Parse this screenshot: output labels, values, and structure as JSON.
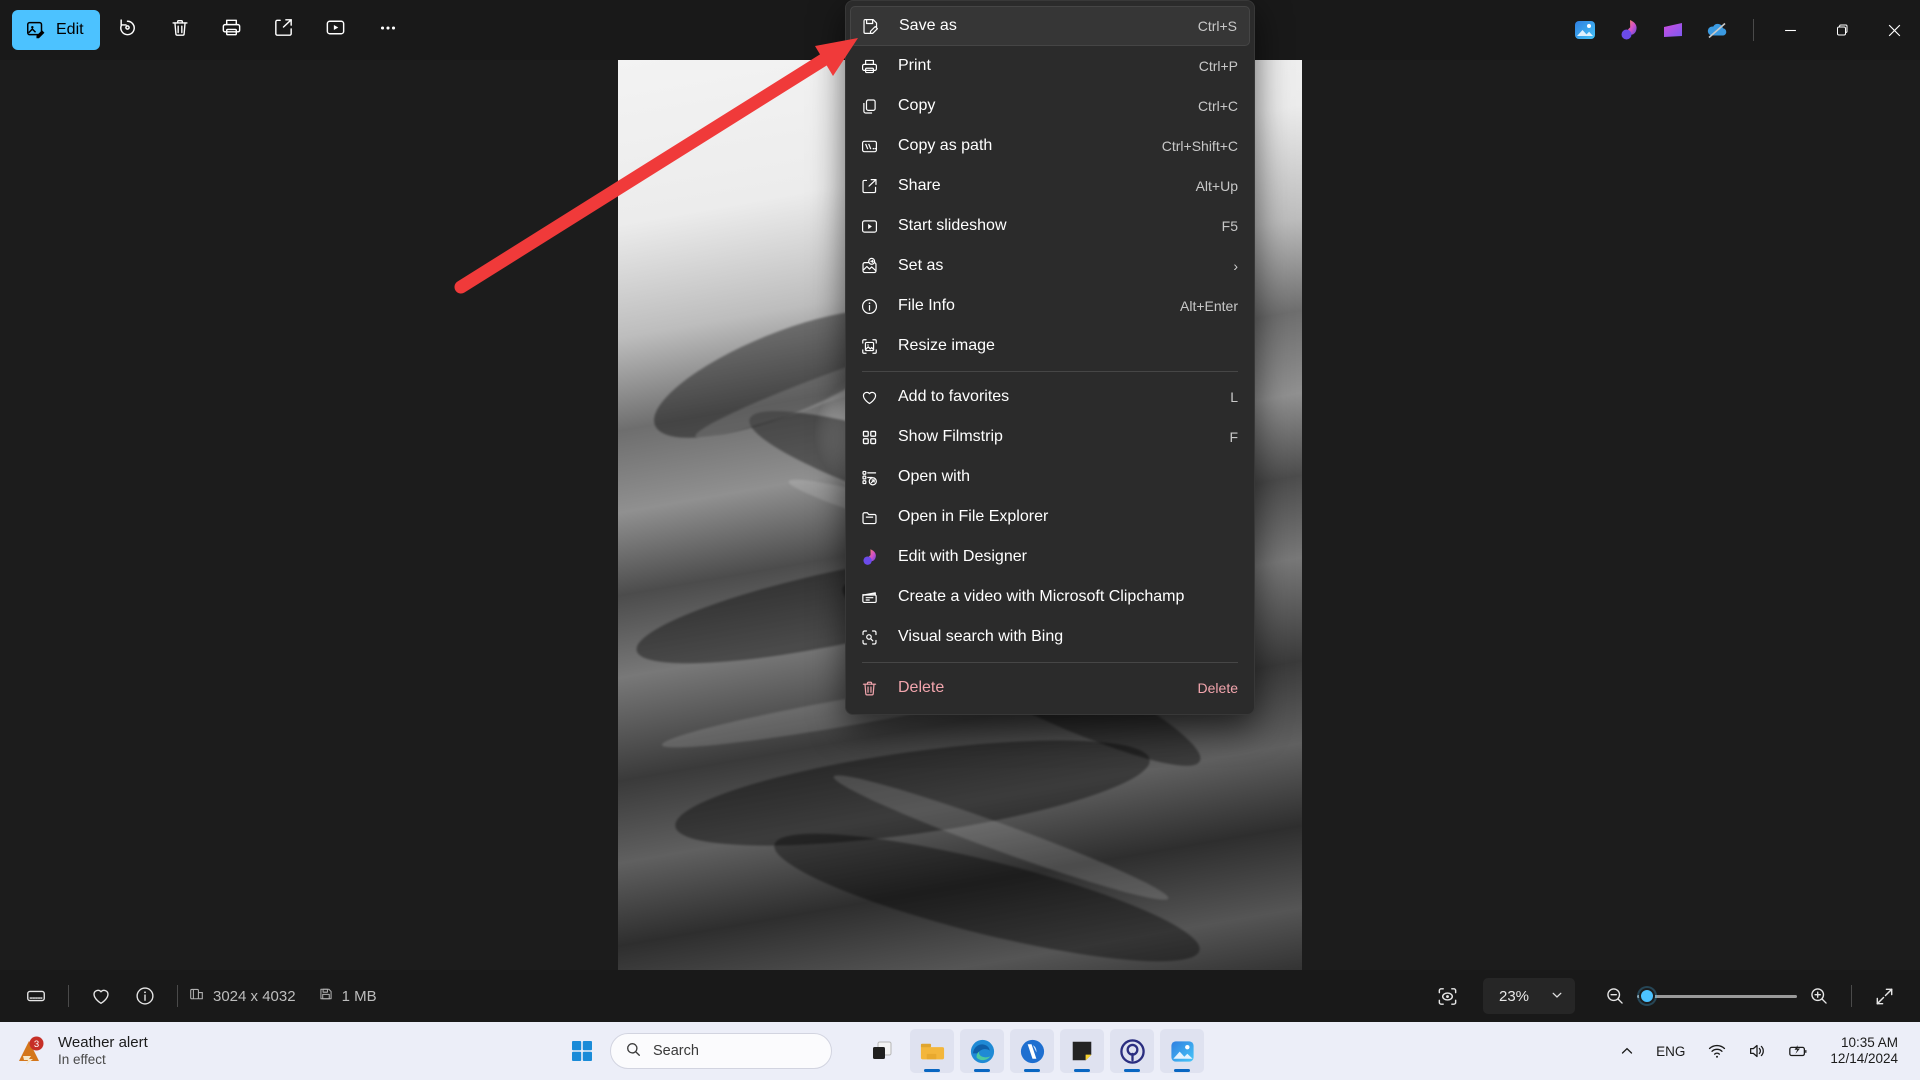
{
  "toolbar": {
    "edit_label": "Edit",
    "buttons": [
      {
        "name": "rotate-icon",
        "title": "Rotate"
      },
      {
        "name": "delete-icon",
        "title": "Delete"
      },
      {
        "name": "print-icon",
        "title": "Print"
      },
      {
        "name": "share-icon",
        "title": "Share"
      },
      {
        "name": "slideshow-icon",
        "title": "Start slideshow"
      },
      {
        "name": "more-icon",
        "title": "See more"
      }
    ],
    "app_icons": [
      "photos-icon",
      "designer-icon",
      "clipchamp-icon",
      "onedrive-paused-icon"
    ],
    "window_controls": {
      "minimize": "—",
      "maximize": "❐",
      "close": "✕"
    }
  },
  "context_menu": {
    "items": [
      {
        "label": "Save as",
        "accel": "Ctrl+S",
        "icon": "save-as-icon",
        "selected": true,
        "sep_after": false
      },
      {
        "label": "Print",
        "accel": "Ctrl+P",
        "icon": "print-icon",
        "selected": false,
        "sep_after": false
      },
      {
        "label": "Copy",
        "accel": "Ctrl+C",
        "icon": "copy-icon",
        "selected": false,
        "sep_after": false
      },
      {
        "label": "Copy as path",
        "accel": "Ctrl+Shift+C",
        "icon": "copy-path-icon",
        "selected": false,
        "sep_after": false
      },
      {
        "label": "Share",
        "accel": "Alt+Up",
        "icon": "share-icon",
        "selected": false,
        "sep_after": false
      },
      {
        "label": "Start slideshow",
        "accel": "F5",
        "icon": "slideshow-icon",
        "selected": false,
        "sep_after": false
      },
      {
        "label": "Set as",
        "accel": "›",
        "icon": "set-as-icon",
        "selected": false,
        "sep_after": false,
        "submenu": true
      },
      {
        "label": "File Info",
        "accel": "Alt+Enter",
        "icon": "info-icon",
        "selected": false,
        "sep_after": false
      },
      {
        "label": "Resize image",
        "accel": "",
        "icon": "resize-image-icon",
        "selected": false,
        "sep_after": true
      },
      {
        "label": "Add to favorites",
        "accel": "L",
        "icon": "heart-icon",
        "selected": false,
        "sep_after": false
      },
      {
        "label": "Show Filmstrip",
        "accel": "F",
        "icon": "filmstrip-icon",
        "selected": false,
        "sep_after": false
      },
      {
        "label": "Open with",
        "accel": "",
        "icon": "open-with-icon",
        "selected": false,
        "sep_after": false
      },
      {
        "label": "Open in File Explorer",
        "accel": "",
        "icon": "folder-icon",
        "selected": false,
        "sep_after": false
      },
      {
        "label": "Edit with Designer",
        "accel": "",
        "icon": "designer-icon",
        "selected": false,
        "sep_after": false
      },
      {
        "label": "Create a video with Microsoft Clipchamp",
        "accel": "",
        "icon": "clipchamp-icon",
        "selected": false,
        "sep_after": false
      },
      {
        "label": "Visual search with Bing",
        "accel": "",
        "icon": "visual-search-icon",
        "selected": false,
        "sep_after": true
      },
      {
        "label": "Delete",
        "accel": "Delete",
        "icon": "trash-icon",
        "selected": false,
        "sep_after": false,
        "danger": true
      }
    ]
  },
  "status_bar": {
    "filmstrip_label": "Show Filmstrip",
    "favorite_label": "Add to favorites",
    "info_label": "File info",
    "dimensions": "3024 x 4032",
    "file_size": "1 MB",
    "fit_label": "Fit to window",
    "zoom_value": "23%",
    "zoom_out_label": "Zoom out",
    "zoom_in_label": "Zoom in",
    "fullscreen_label": "Full screen"
  },
  "taskbar": {
    "weather": {
      "title": "Weather alert",
      "subtitle": "In effect",
      "badge": "3"
    },
    "search_placeholder": "Search",
    "apps": [
      {
        "name": "taskview-icon",
        "active": false
      },
      {
        "name": "file-explorer-icon",
        "active": true
      },
      {
        "name": "edge-icon",
        "active": true
      },
      {
        "name": "vlc-icon",
        "active": true
      },
      {
        "name": "sticky-notes-icon",
        "active": true
      },
      {
        "name": "pia-icon",
        "active": true
      },
      {
        "name": "photos-icon",
        "active": true
      }
    ],
    "tray": {
      "chevron": "˄",
      "language": "ENG",
      "network_label": "Internet access",
      "volume_label": "Volume",
      "battery_label": "Battery",
      "time": "10:35 AM",
      "date": "12/14/2024"
    }
  },
  "colors": {
    "accent": "#4cc2ff",
    "menu_bg": "#2b2b2b",
    "danger": "#f2a5ad",
    "arrow": "#f03a3a",
    "taskbar_bg": "#eceef8"
  }
}
